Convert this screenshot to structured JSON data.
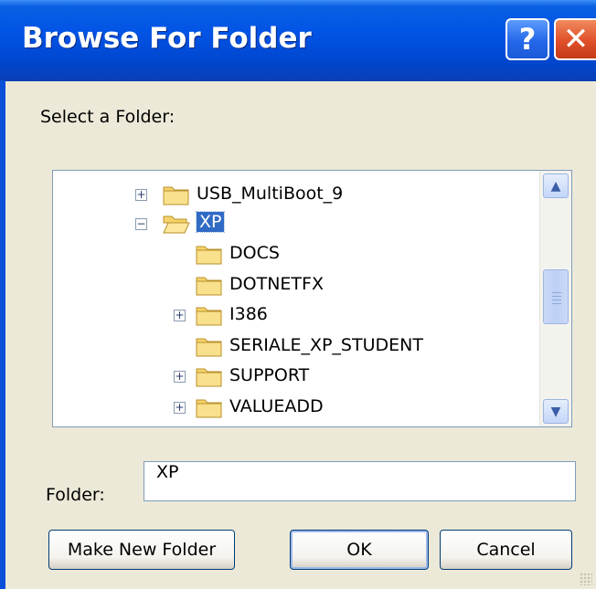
{
  "window": {
    "title": "Browse For Folder",
    "help_glyph": "?",
    "close_glyph": "✕"
  },
  "prompt": "Select a Folder:",
  "tree": {
    "items": [
      {
        "label": "USB_MultiBoot_9",
        "expander": "+",
        "state": "closed"
      },
      {
        "label": "XP",
        "expander": "−",
        "state": "open",
        "selected": true
      },
      {
        "label": "DOCS",
        "expander": "",
        "state": "closed"
      },
      {
        "label": "DOTNETFX",
        "expander": "",
        "state": "closed"
      },
      {
        "label": "I386",
        "expander": "+",
        "state": "closed"
      },
      {
        "label": "SERIALE_XP_STUDENT",
        "expander": "",
        "state": "closed"
      },
      {
        "label": "SUPPORT",
        "expander": "+",
        "state": "closed"
      },
      {
        "label": "VALUEADD",
        "expander": "+",
        "state": "closed"
      }
    ],
    "scroll_up_glyph": "▲",
    "scroll_down_glyph": "▼"
  },
  "folder_field": {
    "label": "Folder:",
    "value": "XP"
  },
  "buttons": {
    "make_new": "Make New Folder",
    "ok": "OK",
    "cancel": "Cancel"
  },
  "colors": {
    "title_bar": "#0254e6",
    "selection": "#316ac5",
    "dialog_bg": "#ece9d8"
  }
}
